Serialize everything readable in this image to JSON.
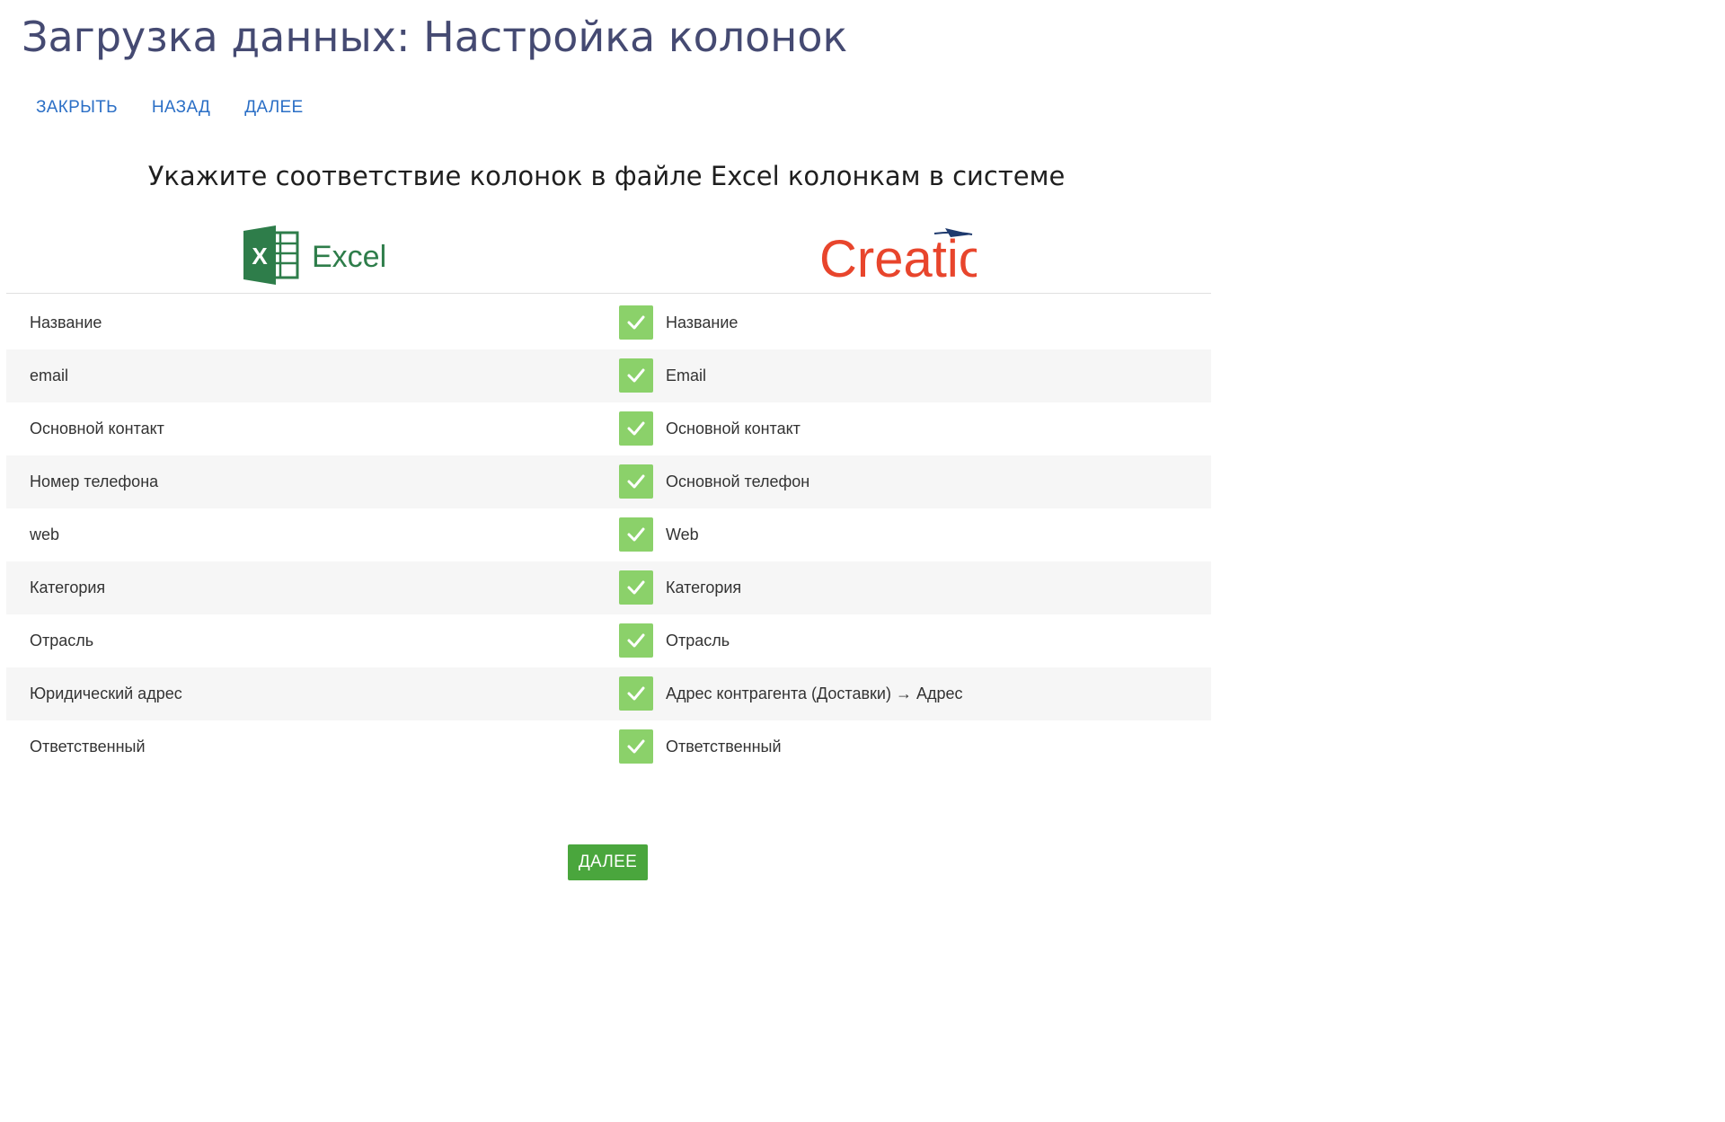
{
  "page": {
    "title": "Загрузка данных: Настройка колонок"
  },
  "toolbar": {
    "close_label": "ЗАКРЫТЬ",
    "back_label": "НАЗАД",
    "next_label": "ДАЛЕЕ"
  },
  "instruction": "Укажите соответствие колонок в файле Excel колонкам в системе",
  "logos": {
    "excel": {
      "icon": "excel-icon",
      "text": "Excel",
      "color": "#2e7d4a"
    },
    "system": {
      "icon": "creatio-logo",
      "text": "Creatio",
      "color": "#e8452c"
    }
  },
  "colors": {
    "title": "#454a72",
    "link": "#2b6fc6",
    "check": "#8bd16a",
    "primary_button": "#4aa63d",
    "row_alt": "#f6f6f6"
  },
  "mappings": [
    {
      "excel": "Название",
      "system": "Название",
      "matched": true
    },
    {
      "excel": "email",
      "system": "Email",
      "matched": true
    },
    {
      "excel": "Основной контакт",
      "system": "Основной контакт",
      "matched": true
    },
    {
      "excel": "Номер телефона",
      "system": "Основной телефон",
      "matched": true
    },
    {
      "excel": "web",
      "system": "Web",
      "matched": true
    },
    {
      "excel": "Категория",
      "system": "Категория",
      "matched": true
    },
    {
      "excel": "Отрасль",
      "system": "Отрасль",
      "matched": true
    },
    {
      "excel": "Юридический адрес",
      "system": "Адрес контрагента (Доставки) → Адрес",
      "matched": true
    },
    {
      "excel": "Ответственный",
      "system": "Ответственный",
      "matched": true
    }
  ],
  "footer": {
    "next_button_label": "ДАЛЕЕ"
  }
}
